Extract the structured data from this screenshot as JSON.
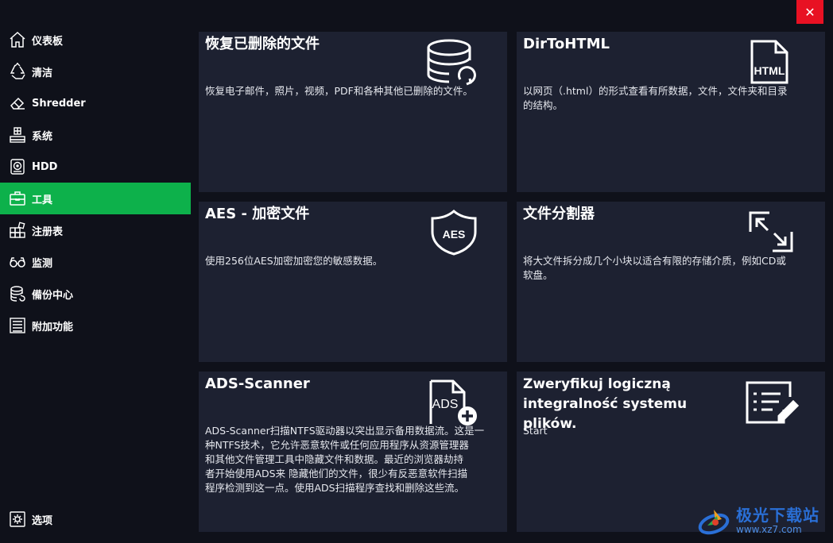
{
  "window": {
    "close_label": "✕"
  },
  "sidebar": {
    "items": [
      {
        "label": "仪表板",
        "icon": "home-icon"
      },
      {
        "label": "清洁",
        "icon": "recycle-icon"
      },
      {
        "label": "Shredder",
        "icon": "eraser-icon"
      },
      {
        "label": "系统",
        "icon": "system-icon"
      },
      {
        "label": "HDD",
        "icon": "hdd-icon"
      },
      {
        "label": "工具",
        "icon": "toolbox-icon",
        "active": true
      },
      {
        "label": "注册表",
        "icon": "registry-icon"
      },
      {
        "label": "监测",
        "icon": "glasses-icon"
      },
      {
        "label": "備份中心",
        "icon": "database-icon"
      },
      {
        "label": "附加功能",
        "icon": "list-icon"
      }
    ],
    "settings_label": "选项"
  },
  "tiles": {
    "recover": {
      "title": "恢复已删除的文件",
      "desc": "恢复电子邮件，照片，视频，PDF和各种其他已删除的文件。",
      "icon": "database-restore-icon"
    },
    "dirtohtml": {
      "title": "DirToHTML",
      "desc_line1": "以网页（.html）的形式查看有所数据，文件，文件夹和目录",
      "desc_line2": "的结构。",
      "icon": "html-file-icon",
      "icon_text": "HTML"
    },
    "aes": {
      "title": "AES - 加密文件",
      "desc": "使用256位AES加密加密您的敏感数据。",
      "icon": "shield-aes-icon",
      "icon_text": "AES"
    },
    "splitter": {
      "title": "文件分割器",
      "desc_line1": "将大文件拆分成几个小块以适合有限的存储介质，例如CD或",
      "desc_line2": "软盘。",
      "icon": "split-icon"
    },
    "ads": {
      "title": "ADS-Scanner",
      "desc_lines": [
        "ADS-Scanner扫描NTFS驱动器以突出显示备用数据流。这是一",
        "种NTFS技术，它允许恶意软件或任何应用程序从资源管理器",
        "和其他文件管理工具中隐藏文件和数据。最近的浏览器劫持",
        "者开始使用ADS来 隐藏他们的文件，很少有反恶意软件扫描",
        "程序检测到这一点。使用ADS扫描程序查找和删除这些流。"
      ],
      "icon": "ads-file-add-icon",
      "icon_text": "ADS"
    },
    "verify": {
      "title_line1": "Zweryfikuj logiczną",
      "title_line2": "integralność systemu plików.",
      "desc": "Start",
      "icon": "checklist-edit-icon"
    }
  },
  "watermark": {
    "cn": "极光下载站",
    "url": "www.xz7.com"
  },
  "colors": {
    "accent": "#0db14b",
    "tile_bg": "#1d2131",
    "bg": "#0f111a",
    "close": "#e81123"
  }
}
